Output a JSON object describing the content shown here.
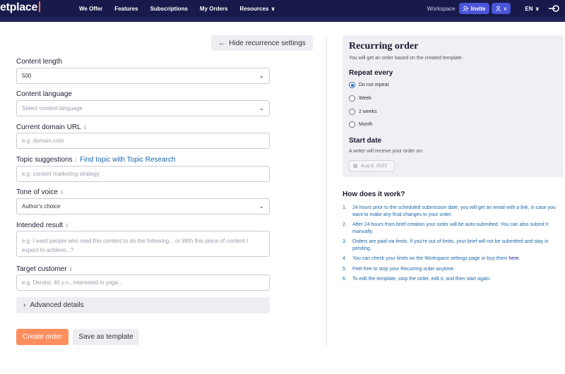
{
  "topbar": {
    "logo": "etplace",
    "nav": [
      "We Offer",
      "Features",
      "Subscriptions",
      "My Orders",
      "Resources"
    ],
    "workspace_label": "Workspace",
    "invite_label": "Invite",
    "lang": "EN"
  },
  "form": {
    "hide_recurrence_label": "Hide recurrence settings",
    "content_length": {
      "label": "Content length",
      "value": "500"
    },
    "content_language": {
      "label": "Content language",
      "placeholder": "Select content language"
    },
    "domain_url": {
      "label": "Current domain URL",
      "placeholder": "e.g. domain.com"
    },
    "topic": {
      "label": "Topic suggestions",
      "link": "Find topic with Topic Research",
      "placeholder": "e.g. content marketing strategy"
    },
    "tone": {
      "label": "Tone of voice",
      "value": "Author's choice"
    },
    "intended": {
      "label": "Intended result",
      "placeholder": "e.g. I want people who read this content to do the following... or With this piece of content I expect to achieve...?"
    },
    "target": {
      "label": "Target customer",
      "placeholder": "e.g. Dentist, 40 y.o., interested in yoga..."
    },
    "advanced_label": "Advanced details",
    "create_label": "Create order",
    "template_label": "Save as template"
  },
  "recurring": {
    "title": "Recurring order",
    "subtitle": "You will get an order based on the created template.",
    "repeat_heading": "Repeat every",
    "options": [
      {
        "label": "Do not repeat",
        "selected": true
      },
      {
        "label": "Week",
        "selected": false
      },
      {
        "label": "2 weeks",
        "selected": false
      },
      {
        "label": "Month",
        "selected": false
      }
    ],
    "start_heading": "Start date",
    "start_sub": "A writer will receive your order on:",
    "start_date": "Aug 8, 2022"
  },
  "how": {
    "title": "How does it work?",
    "steps": [
      "24 hours prior to the scheduled submission date, you will get an email with a link, in case you want to make any final changes to your order.",
      "After 24 hours from brief creation your order will be auto-submitted. You can also submit it manually.",
      "Orders are paid via limits. If you're out of limits, your brief will not be submitted and stay in pending.",
      "You can check your limits on the Workspace settings page or buy them",
      "Feel free to stop your Recurring order anytime.",
      "To edit the template, stop the order, edit it, and then start again."
    ],
    "step4_link": "here."
  }
}
